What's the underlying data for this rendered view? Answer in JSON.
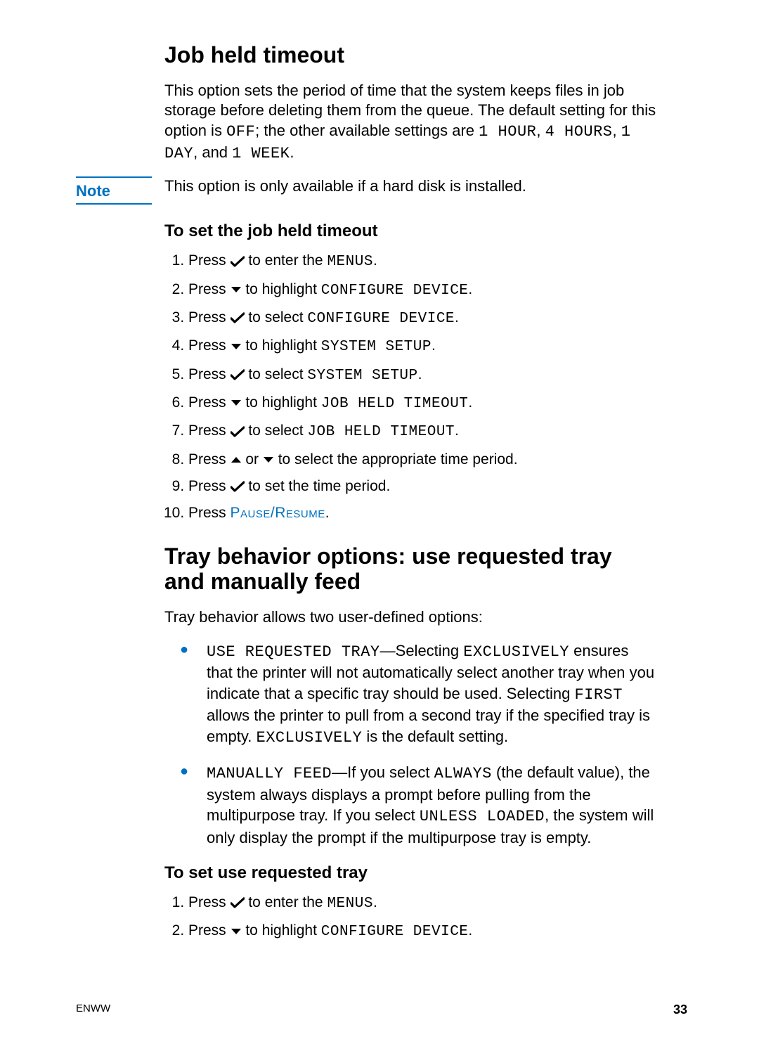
{
  "section1": {
    "title": "Job held timeout",
    "intro_parts": [
      "This option sets the period of time that the system keeps files in job storage before deleting them from the queue. The default setting for this option is ",
      "OFF",
      "; the other available settings are ",
      "1 HOUR",
      ", ",
      "4 HOURS",
      ", ",
      "1 DAY",
      ", and ",
      "1 WEEK",
      "."
    ],
    "note_label": "Note",
    "note_text": "This option is only available if a hard disk is installed.",
    "sub_title": "To set the job held timeout",
    "steps": [
      {
        "pre": "Press ",
        "icon": "check",
        "post_a": " to enter the ",
        "mono": "MENUS",
        "tail": "."
      },
      {
        "pre": "Press ",
        "icon": "down",
        "post_a": " to highlight ",
        "mono": "CONFIGURE DEVICE",
        "tail": "."
      },
      {
        "pre": "Press ",
        "icon": "check",
        "post_a": " to select ",
        "mono": "CONFIGURE DEVICE",
        "tail": "."
      },
      {
        "pre": "Press ",
        "icon": "down",
        "post_a": " to highlight ",
        "mono": "SYSTEM SETUP",
        "tail": "."
      },
      {
        "pre": "Press ",
        "icon": "check",
        "post_a": " to select ",
        "mono": "SYSTEM SETUP",
        "tail": "."
      },
      {
        "pre": "Press ",
        "icon": "down",
        "post_a": " to highlight ",
        "mono": "JOB HELD TIMEOUT",
        "tail": "."
      },
      {
        "pre": "Press ",
        "icon": "check",
        "post_a": " to select ",
        "mono": "JOB HELD TIMEOUT",
        "tail": "."
      },
      {
        "pre": "Press ",
        "icon": "up",
        "mid": " or ",
        "icon2": "down",
        "post_a": " to select the appropriate time period.",
        "mono": "",
        "tail": ""
      },
      {
        "pre": "Press ",
        "icon": "check",
        "post_a": " to set the time period.",
        "mono": "",
        "tail": ""
      },
      {
        "pre": "Press ",
        "smallcaps": "Pause/Resume",
        "tail": "."
      }
    ]
  },
  "section2": {
    "title": "Tray behavior options: use requested tray and manually feed",
    "intro": "Tray behavior allows two user-defined options:",
    "bullets": [
      {
        "segments": [
          {
            "t": "mono",
            "v": "USE REQUESTED TRAY"
          },
          {
            "t": "text",
            "v": "—Selecting "
          },
          {
            "t": "mono",
            "v": "EXCLUSIVELY"
          },
          {
            "t": "text",
            "v": " ensures that the printer will not automatically select another tray when you indicate that a specific tray should be used. Selecting "
          },
          {
            "t": "mono",
            "v": "FIRST"
          },
          {
            "t": "text",
            "v": " allows the printer to pull from a second tray if the specified tray is empty. "
          },
          {
            "t": "mono",
            "v": "EXCLUSIVELY"
          },
          {
            "t": "text",
            "v": " is the default setting."
          }
        ]
      },
      {
        "segments": [
          {
            "t": "mono",
            "v": "MANUALLY FEED"
          },
          {
            "t": "text",
            "v": "—If you select "
          },
          {
            "t": "mono",
            "v": "ALWAYS"
          },
          {
            "t": "text",
            "v": " (the default value), the system always displays a prompt before pulling from the multipurpose tray. If you select "
          },
          {
            "t": "mono",
            "v": "UNLESS LOADED"
          },
          {
            "t": "text",
            "v": ", the system will only display the prompt if the multipurpose tray is empty."
          }
        ]
      }
    ],
    "sub_title": "To set use requested tray",
    "steps2": [
      {
        "pre": "Press ",
        "icon": "check",
        "post_a": " to enter the ",
        "mono": "MENUS",
        "tail": "."
      },
      {
        "pre": "Press ",
        "icon": "down",
        "post_a": " to highlight ",
        "mono": "CONFIGURE DEVICE",
        "tail": "."
      }
    ]
  },
  "footer": {
    "left": "ENWW",
    "page": "33"
  }
}
